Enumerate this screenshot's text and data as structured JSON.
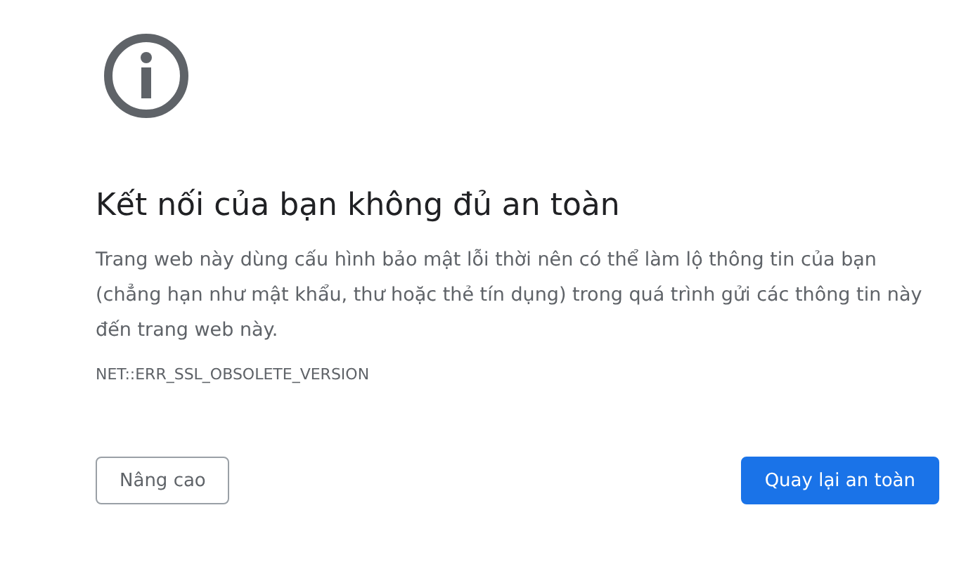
{
  "heading": "Kết nối của bạn không đủ an toàn",
  "message": "Trang web này dùng cấu hình bảo mật lỗi thời nên có thể làm lộ thông tin của bạn (chẳng hạn như mật khẩu, thư hoặc thẻ tín dụng) trong quá trình gửi các thông tin này đến trang web này.",
  "error_code": "NET::ERR_SSL_OBSOLETE_VERSION",
  "buttons": [
    {
      "label": "Nâng cao",
      "kind": "secondary"
    },
    {
      "label": "Quay lại an toàn",
      "kind": "primary"
    }
  ]
}
